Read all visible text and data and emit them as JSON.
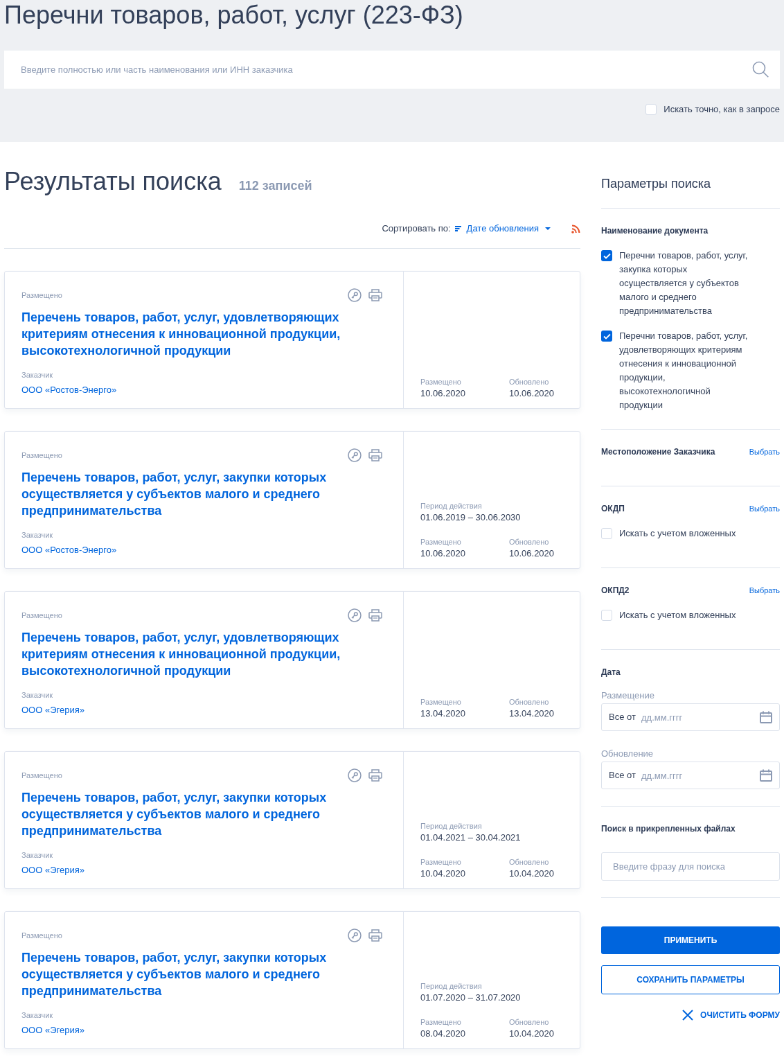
{
  "page_title": "Перечни товаров, работ, услуг (223-ФЗ)",
  "search": {
    "placeholder": "Введите полностью или часть наименования или ИНН заказчика"
  },
  "exact_match": {
    "label": "Искать точно, как в запросе",
    "checked": false
  },
  "results": {
    "title": "Результаты поиска",
    "count": "112 записей",
    "sort_label": "Сортировать по:",
    "sort_value": "Дате обновления"
  },
  "cards": [
    {
      "status": "Размещено",
      "title": "Перечень товаров, работ, услуг, удовлетворяющих критериям отнесения к инновационной продукции, высокотехнологичной продукции",
      "customer_label": "Заказчик",
      "customer": "ООО «Ростов-Энерго»",
      "dates": [
        {
          "label": "Размещено",
          "value": "10.06.2020"
        },
        {
          "label": "Обновлено",
          "value": "10.06.2020"
        }
      ]
    },
    {
      "status": "Размещено",
      "title": "Перечень товаров, работ, услуг, закупки которых осуществляется у субъектов малого и среднего предпринимательства",
      "customer_label": "Заказчик",
      "customer": "ООО «Ростов-Энерго»",
      "period": {
        "label": "Период действия",
        "value": "01.06.2019 – 30.06.2030"
      },
      "dates": [
        {
          "label": "Размещено",
          "value": "10.06.2020"
        },
        {
          "label": "Обновлено",
          "value": "10.06.2020"
        }
      ]
    },
    {
      "status": "Размещено",
      "title": "Перечень товаров, работ, услуг, удовлетворяющих критериям отнесения к инновационной продукции, высокотехнологичной продукции",
      "customer_label": "Заказчик",
      "customer": "ООО «Эгерия»",
      "dates": [
        {
          "label": "Размещено",
          "value": "13.04.2020"
        },
        {
          "label": "Обновлено",
          "value": "13.04.2020"
        }
      ]
    },
    {
      "status": "Размещено",
      "title": "Перечень товаров, работ, услуг, закупки которых осуществляется у субъектов малого и среднего предпринимательства",
      "customer_label": "Заказчик",
      "customer": "ООО «Эгерия»",
      "period": {
        "label": "Период действия",
        "value": "01.04.2021 – 30.04.2021"
      },
      "dates": [
        {
          "label": "Размещено",
          "value": "10.04.2020"
        },
        {
          "label": "Обновлено",
          "value": "10.04.2020"
        }
      ]
    },
    {
      "status": "Размещено",
      "title": "Перечень товаров, работ, услуг, закупки которых осуществляется у субъектов малого и среднего предпринимательства",
      "customer_label": "Заказчик",
      "customer": "ООО «Эгерия»",
      "period": {
        "label": "Период действия",
        "value": "01.07.2020 – 31.07.2020"
      },
      "dates": [
        {
          "label": "Размещено",
          "value": "08.04.2020"
        },
        {
          "label": "Обновлено",
          "value": "10.04.2020"
        }
      ]
    }
  ],
  "filters": {
    "title": "Параметры поиска",
    "sections": [
      {
        "kind": "checklist",
        "title": "Наименование документа",
        "options": [
          {
            "label": "Перечни товаров, работ, услуг, закупка которых осуществляется у субъектов малого и среднего предпринимательства",
            "checked": true
          },
          {
            "label": "Перечни товаров, работ, услуг, удовлетворяющих критериям отнесения к инновационной продукции, высокотехнологичной продукции",
            "checked": true
          }
        ]
      },
      {
        "kind": "picker",
        "title": "Местоположение Заказчика",
        "action": "Выбрать"
      },
      {
        "kind": "picker",
        "title": "ОКДП",
        "action": "Выбрать",
        "option": {
          "label": "Искать с учетом вложенных",
          "checked": false
        }
      },
      {
        "kind": "picker",
        "title": "ОКПД2",
        "action": "Выбрать",
        "option": {
          "label": "Искать с учетом вложенных",
          "checked": false
        }
      },
      {
        "kind": "dates",
        "title": "Дата",
        "fields": [
          {
            "label": "Размещение",
            "prefix": "Все от",
            "placeholder": "дд.мм.гггг"
          },
          {
            "label": "Обновление",
            "prefix": "Все от",
            "placeholder": "дд.мм.гггг"
          }
        ]
      },
      {
        "kind": "text",
        "title": "Поиск в прикрепленных файлах",
        "placeholder": "Введите фразу для поиска"
      }
    ],
    "apply": "ПРИМЕНИТЬ",
    "save": "СОХРАНИТЬ ПАРАМЕТРЫ",
    "clear": "ОЧИСТИТЬ ФОРМУ"
  }
}
